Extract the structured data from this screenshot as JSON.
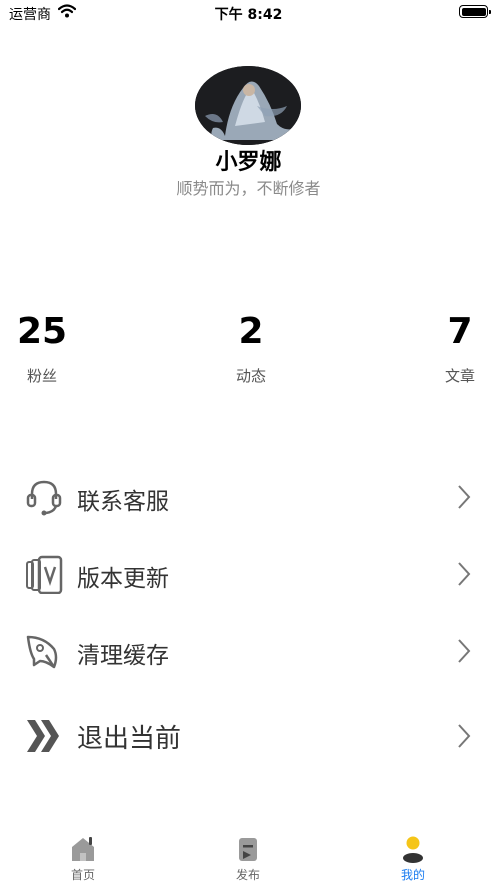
{
  "status_bar": {
    "carrier": "运营商",
    "time": "下午 8:42"
  },
  "profile": {
    "name": "小罗娜",
    "signature": "顺势而为，不断修者"
  },
  "stats": [
    {
      "value": "25",
      "label": "粉丝"
    },
    {
      "value": "2",
      "label": "动态"
    },
    {
      "value": "7",
      "label": "文章"
    }
  ],
  "menu": [
    {
      "label": "联系客服",
      "icon": "headset-icon"
    },
    {
      "label": "版本更新",
      "icon": "version-card-icon"
    },
    {
      "label": "清理缓存",
      "icon": "rocket-icon"
    },
    {
      "label": "退出当前",
      "icon": "double-chevron-icon"
    }
  ],
  "tabbar": [
    {
      "label": "首页",
      "icon": "home-icon"
    },
    {
      "label": "发布",
      "icon": "publish-icon"
    },
    {
      "label": "我的",
      "icon": "profile-icon",
      "active": true
    }
  ],
  "colors": {
    "accent": "#1a7cf0",
    "avatar_dot": "#f5c518",
    "icon_gray": "#9a9a9a"
  }
}
